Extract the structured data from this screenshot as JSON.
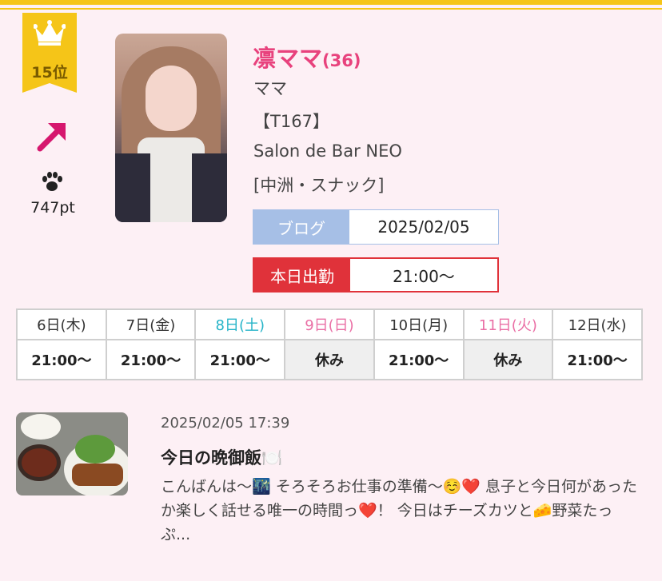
{
  "ranking": {
    "rank_label": "15位",
    "trend": "up",
    "points_label": "747pt"
  },
  "profile": {
    "name": "凛ママ",
    "age": "(36)",
    "position": "ママ",
    "height": "【T167】",
    "shop": "Salon de Bar NEO",
    "area": "[中洲・スナック]"
  },
  "blog_badge": {
    "label": "ブログ",
    "value": "2025/02/05"
  },
  "work_badge": {
    "label": "本日出勤",
    "value": "21:00〜"
  },
  "schedule": [
    {
      "day": "6日(木)",
      "time": "21:00〜"
    },
    {
      "day": "7日(金)",
      "time": "21:00〜"
    },
    {
      "day": "8日(土)",
      "time": "21:00〜"
    },
    {
      "day": "9日(日)",
      "time": "休み"
    },
    {
      "day": "10日(月)",
      "time": "21:00〜"
    },
    {
      "day": "11日(火)",
      "time": "休み"
    },
    {
      "day": "12日(水)",
      "time": "21:00〜"
    }
  ],
  "post": {
    "date": "2025/02/05 17:39",
    "title": "今日の晩御飯🍽️",
    "excerpt": "こんばんは〜🌃 そろそろお仕事の準備〜☺️❤️ 息子と今日何があったか楽しく話せる唯一の時間っ❤️！ 今日はチーズカツと🧀野菜たっぷ..."
  },
  "colors": {
    "accent_gold": "#f5c518",
    "name_pink": "#e8427d",
    "blog_blue": "#a6bfe6",
    "work_red": "#e0323a",
    "saturday": "#26b4c8",
    "sunday_holiday": "#ea6fa5"
  },
  "icons": {
    "crown": "crown-icon",
    "trend": "trend-up-arrow-icon",
    "points": "paw-print-icon"
  }
}
